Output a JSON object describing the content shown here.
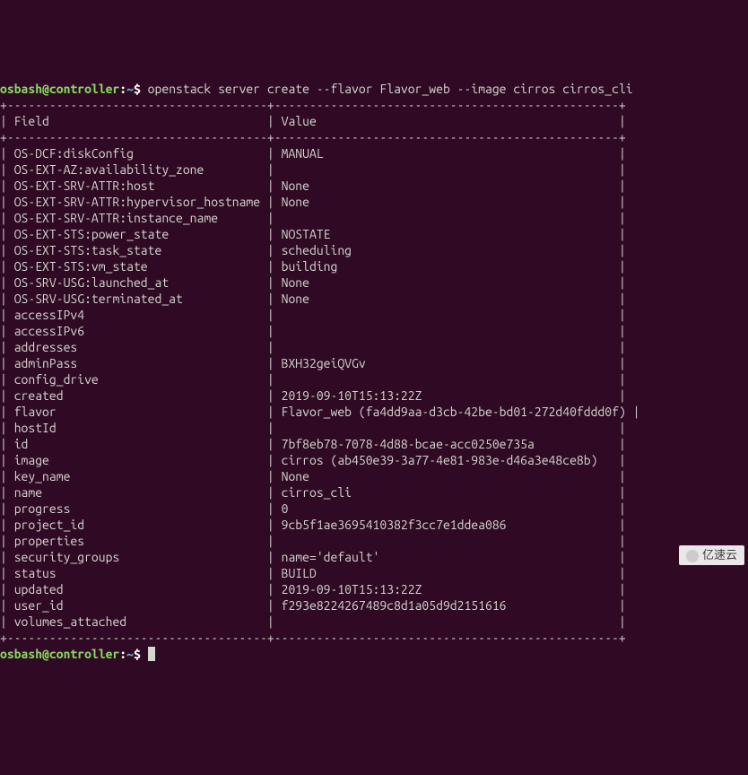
{
  "prompt": {
    "user": "osbash",
    "at": "@",
    "host": "controller",
    "colon": ":",
    "path": "~",
    "symbol": "$",
    "command": " openstack server create --flavor Flavor_web --image cirros cirros_cli"
  },
  "columns": {
    "field": "Field",
    "value": "Value"
  },
  "rows": [
    {
      "field": "OS-DCF:diskConfig",
      "value": "MANUAL"
    },
    {
      "field": "OS-EXT-AZ:availability_zone",
      "value": ""
    },
    {
      "field": "OS-EXT-SRV-ATTR:host",
      "value": "None"
    },
    {
      "field": "OS-EXT-SRV-ATTR:hypervisor_hostname",
      "value": "None"
    },
    {
      "field": "OS-EXT-SRV-ATTR:instance_name",
      "value": ""
    },
    {
      "field": "OS-EXT-STS:power_state",
      "value": "NOSTATE"
    },
    {
      "field": "OS-EXT-STS:task_state",
      "value": "scheduling"
    },
    {
      "field": "OS-EXT-STS:vm_state",
      "value": "building"
    },
    {
      "field": "OS-SRV-USG:launched_at",
      "value": "None"
    },
    {
      "field": "OS-SRV-USG:terminated_at",
      "value": "None"
    },
    {
      "field": "accessIPv4",
      "value": ""
    },
    {
      "field": "accessIPv6",
      "value": ""
    },
    {
      "field": "addresses",
      "value": ""
    },
    {
      "field": "adminPass",
      "value": "BXH32geiQVGv"
    },
    {
      "field": "config_drive",
      "value": ""
    },
    {
      "field": "created",
      "value": "2019-09-10T15:13:22Z"
    },
    {
      "field": "flavor",
      "value": "Flavor_web (fa4dd9aa-d3cb-42be-bd01-272d40fddd0f)"
    },
    {
      "field": "hostId",
      "value": ""
    },
    {
      "field": "id",
      "value": "7bf8eb78-7078-4d88-bcae-acc0250e735a"
    },
    {
      "field": "image",
      "value": "cirros (ab450e39-3a77-4e81-983e-d46a3e48ce8b)"
    },
    {
      "field": "key_name",
      "value": "None"
    },
    {
      "field": "name",
      "value": "cirros_cli"
    },
    {
      "field": "progress",
      "value": "0"
    },
    {
      "field": "project_id",
      "value": "9cb5f1ae3695410382f3cc7e1ddea086"
    },
    {
      "field": "properties",
      "value": ""
    },
    {
      "field": "security_groups",
      "value": "name='default'"
    },
    {
      "field": "status",
      "value": "BUILD"
    },
    {
      "field": "updated",
      "value": "2019-09-10T15:13:22Z"
    },
    {
      "field": "user_id",
      "value": "f293e8224267489c8d1a05d9d2151616"
    },
    {
      "field": "volumes_attached",
      "value": ""
    }
  ],
  "watermark": "亿速云"
}
